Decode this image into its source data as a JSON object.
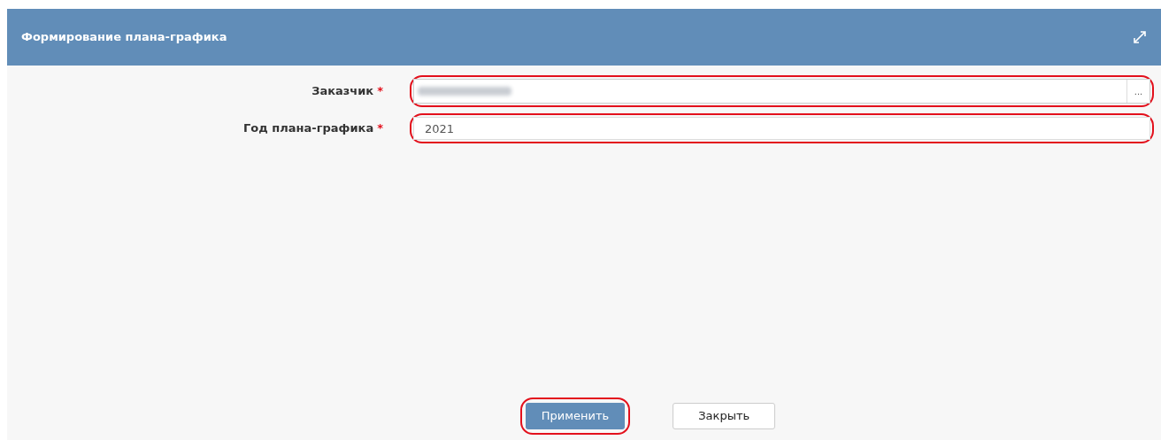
{
  "window": {
    "title": "Формирование плана-графика"
  },
  "fields": [
    {
      "label": "Заказчик",
      "required_mark": "*",
      "kind": "lookup",
      "value_redacted": true,
      "button": "...",
      "highlighted": true
    },
    {
      "label": "Год плана-графика",
      "required_mark": "*",
      "kind": "text",
      "value": "2021",
      "highlighted": true
    }
  ],
  "buttons": [
    {
      "label": "Применить",
      "kind": "primary",
      "highlighted": true
    },
    {
      "label": "Закрыть",
      "kind": "secondary",
      "highlighted": false
    }
  ]
}
